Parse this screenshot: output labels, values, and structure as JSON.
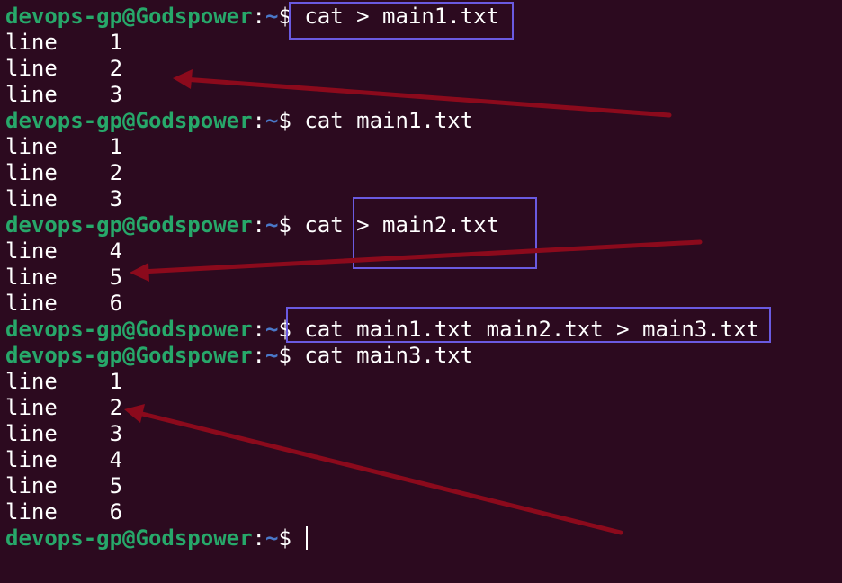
{
  "prompt": {
    "user": "devops-gp@Godspower",
    "colon": ":",
    "path": "~",
    "dollar": "$"
  },
  "lines": [
    {
      "type": "prompt",
      "cmd": "cat > main1.txt"
    },
    {
      "type": "output",
      "text": "line    1"
    },
    {
      "type": "output",
      "text": "line    2"
    },
    {
      "type": "output",
      "text": "line    3"
    },
    {
      "type": "prompt",
      "cmd": "cat main1.txt"
    },
    {
      "type": "output",
      "text": "line    1"
    },
    {
      "type": "output",
      "text": "line    2"
    },
    {
      "type": "output",
      "text": "line    3"
    },
    {
      "type": "prompt",
      "cmd": "cat > main2.txt"
    },
    {
      "type": "output",
      "text": "line    4"
    },
    {
      "type": "output",
      "text": "line    5"
    },
    {
      "type": "output",
      "text": "line    6"
    },
    {
      "type": "prompt",
      "cmd": "cat main1.txt main2.txt > main3.txt"
    },
    {
      "type": "prompt",
      "cmd": "cat main3.txt"
    },
    {
      "type": "output",
      "text": "line    1"
    },
    {
      "type": "output",
      "text": "line    2"
    },
    {
      "type": "output",
      "text": "line    3"
    },
    {
      "type": "output",
      "text": "line    4"
    },
    {
      "type": "output",
      "text": "line    5"
    },
    {
      "type": "output",
      "text": "line    6"
    },
    {
      "type": "prompt",
      "cmd": ""
    }
  ],
  "colors": {
    "background": "#2c0a1f",
    "user": "#27a86a",
    "path": "#4a78c8",
    "highlight_box": "#6a5ae0",
    "arrow": "#8b0a1c"
  }
}
